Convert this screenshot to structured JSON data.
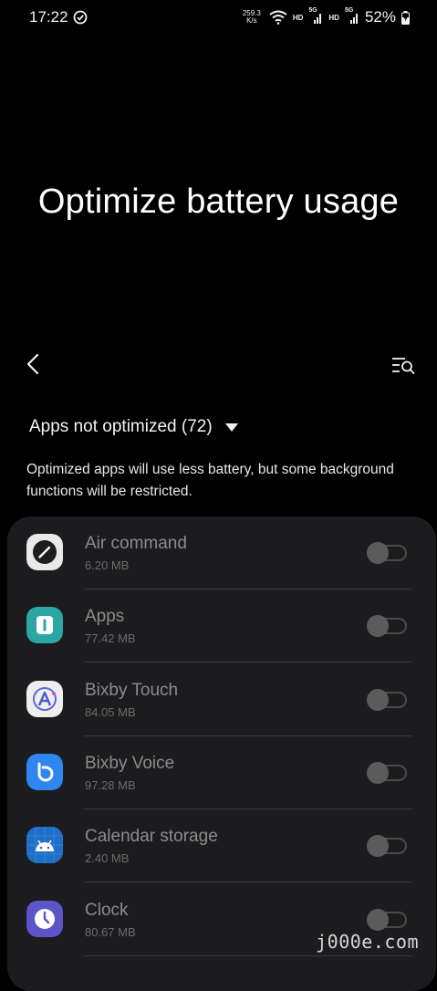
{
  "status_bar": {
    "time": "17:22",
    "net_speed_value": "259.3",
    "net_speed_unit": "K/s",
    "hd1": "HD",
    "sig1": "5G",
    "hd2": "HD",
    "sig2": "5G",
    "battery": "52%"
  },
  "page": {
    "title": "Optimize battery usage"
  },
  "filter": {
    "label": "Apps not optimized (72)",
    "description": "Optimized apps will use less battery, but some background functions will be restricted."
  },
  "apps": [
    {
      "name": "Air command",
      "size": "6.20 MB",
      "icon": "air-command-icon",
      "optimized": false
    },
    {
      "name": "Apps",
      "size": "77.42 MB",
      "icon": "apps-icon",
      "optimized": false
    },
    {
      "name": "Bixby Touch",
      "size": "84.05 MB",
      "icon": "bixby-touch-icon",
      "optimized": false
    },
    {
      "name": "Bixby Voice",
      "size": "97.28 MB",
      "icon": "bixby-voice-icon",
      "optimized": false
    },
    {
      "name": "Calendar storage",
      "size": "2.40 MB",
      "icon": "android-icon",
      "optimized": false
    },
    {
      "name": "Clock",
      "size": "80.67 MB",
      "icon": "clock-icon",
      "optimized": false
    }
  ],
  "watermark": "j000e.com",
  "colors": {
    "background": "#000000",
    "card": "#1c1c1e",
    "disabled_text": "#8c8c8c"
  }
}
